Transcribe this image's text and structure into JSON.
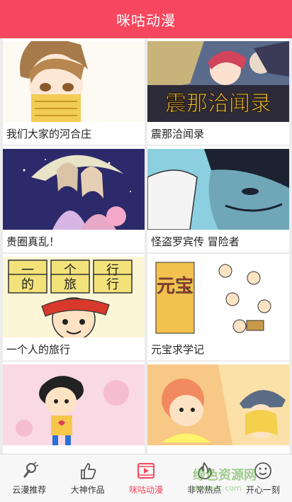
{
  "header": {
    "title": "咪咕动漫"
  },
  "comics": [
    {
      "title": "我们大家的河合庄"
    },
    {
      "title": "震那洽闻录",
      "cover_text": "震那洽闻录"
    },
    {
      "title": "贵圈真乱！"
    },
    {
      "title": "怪盗罗宾传 冒险者"
    },
    {
      "title": "一个人的旅行",
      "cover_text": [
        "一",
        "个",
        "行",
        "的",
        "旅",
        "行"
      ]
    },
    {
      "title": "元宝求学记",
      "cover_text": "元宝"
    },
    {
      "title": ""
    },
    {
      "title": ""
    }
  ],
  "tabs": [
    {
      "label": "云漫推荐",
      "icon": "microphone-icon"
    },
    {
      "label": "大神作品",
      "icon": "thumbs-up-icon"
    },
    {
      "label": "咪咕动漫",
      "icon": "video-play-icon",
      "active": true
    },
    {
      "label": "非常热点",
      "icon": "flame-icon"
    },
    {
      "label": "开心一刻",
      "icon": "smile-icon"
    }
  ],
  "watermark": {
    "text": "绿色资源网",
    "sub": "downcc.com"
  },
  "colors": {
    "accent": "#f6475e",
    "background": "#ececec"
  }
}
